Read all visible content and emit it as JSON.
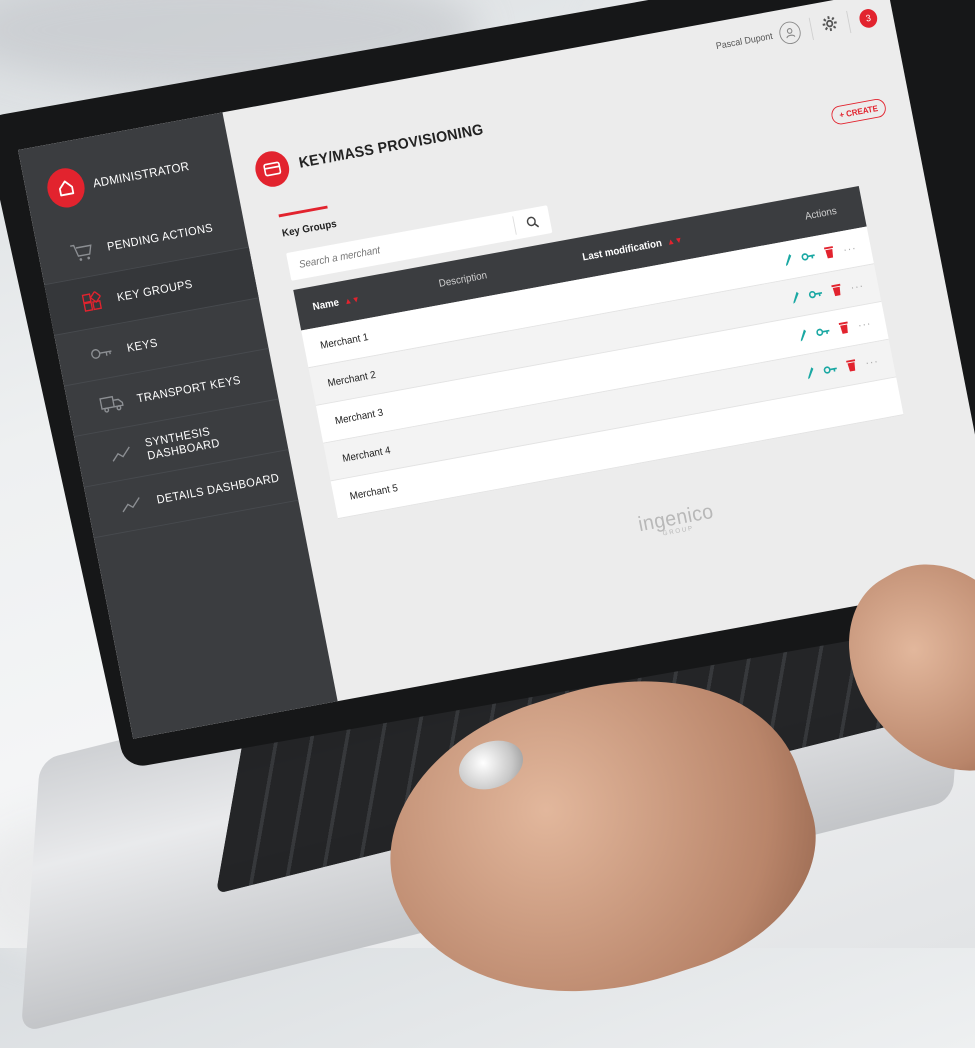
{
  "app": {
    "brand_label": "ADMINISTRATOR",
    "accent_color": "#e2232e",
    "sidebar_color": "#3b3d40"
  },
  "sidebar": {
    "items": [
      {
        "label": "PENDING ACTIONS",
        "icon": "cart-icon"
      },
      {
        "label": "KEY GROUPS",
        "icon": "key-groups-icon"
      },
      {
        "label": "KEYS",
        "icon": "key-icon"
      },
      {
        "label": "TRANSPORT KEYS",
        "icon": "truck-icon"
      },
      {
        "label": "SYNTHESIS DASHBOARD",
        "icon": "chart-line-icon"
      },
      {
        "label": "DETAILS DASHBOARD",
        "icon": "chart-line-icon"
      }
    ]
  },
  "topbar": {
    "user_name": "Pascal Dupont",
    "notification_count": "3"
  },
  "page": {
    "title": "KEY/MASS PROVISIONING",
    "tab_label": "Key Groups",
    "create_label": "+ CREATE"
  },
  "search": {
    "placeholder": "Search a merchant"
  },
  "table": {
    "headers": {
      "name": "Name",
      "description": "Description",
      "last_modification": "Last modification",
      "actions": "Actions"
    },
    "rows": [
      {
        "name": "Merchant 1"
      },
      {
        "name": "Merchant 2"
      },
      {
        "name": "Merchant 3"
      },
      {
        "name": "Merchant 4"
      },
      {
        "name": "Merchant 5"
      }
    ],
    "more_label": "···"
  },
  "footer": {
    "logo_main": "ingenico",
    "logo_sub": "GROUP"
  }
}
